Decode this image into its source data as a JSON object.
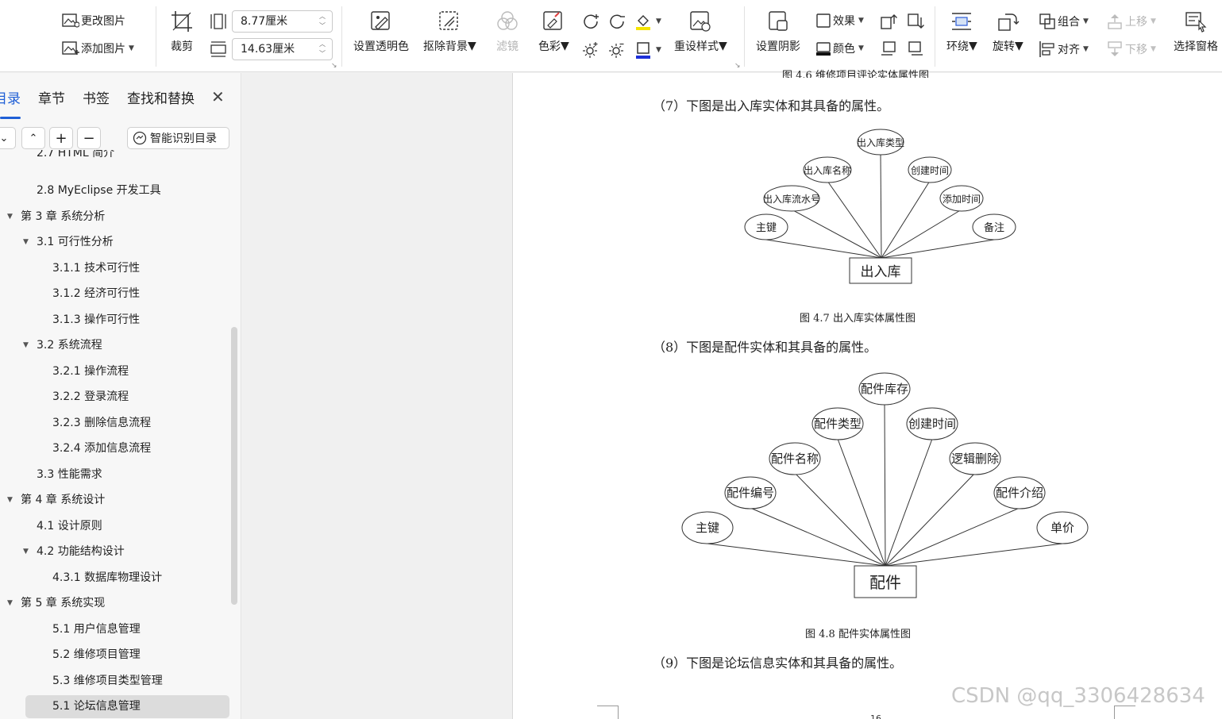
{
  "toolbar": {
    "change_image": "更改图片",
    "add_image": "添加图片",
    "crop": "裁剪",
    "width_value": "8.77厘米",
    "height_value": "14.63厘米",
    "set_transparent": "设置透明色",
    "remove_bg": "抠除背景",
    "filter": "滤镜",
    "color": "色彩",
    "reset_style": "重设样式",
    "set_shadow": "设置阴影",
    "effects": "效果",
    "shadow_color": "颜色",
    "wrap": "环绕",
    "rotate": "旋转",
    "group": "组合",
    "align": "对齐",
    "move_up": "上移",
    "move_down": "下移",
    "selection_pane": "选择窗格"
  },
  "sidebar": {
    "tabs": [
      "目录",
      "章节",
      "书签",
      "查找和替换"
    ],
    "smart_toc": "智能识别目录",
    "toc_partial": "2.7 HTML 简介",
    "toc": [
      "2.8 MyEclipse 开发工具",
      "第 3 章  系统分析",
      "3.1  可行性分析",
      "3.1.1  技术可行性",
      "3.1.2  经济可行性",
      "3.1.3  操作可行性",
      "3.2  系统流程",
      "3.2.1  操作流程",
      "3.2.2  登录流程",
      "3.2.3  删除信息流程",
      "3.2.4  添加信息流程",
      "3.3  性能需求",
      "第 4 章  系统设计",
      "4.1  设计原则",
      "4.2  功能结构设计",
      "4.3.1  数据库物理设计",
      "第 5 章  系统实现",
      "5.1 用户信息管理",
      "5.2  维修项目管理",
      "5.3 维修项目类型管理",
      "5.1 论坛信息管理"
    ]
  },
  "document": {
    "top_caption_partial": "图 4.6  维修项目评论实体属性图",
    "para7": "（7）下图是出入库实体和其具备的属性。",
    "caption7": "图 4.7 出入库实体属性图",
    "para8": "（8）下图是配件实体和其具备的属性。",
    "caption8": "图 4.8 配件实体属性图",
    "para9": "（9）下图是论坛信息实体和其具备的属性。",
    "page_number_partial": "16"
  },
  "diagram1": {
    "entity": "出入库",
    "attributes": [
      "主键",
      "出入库流水号",
      "出入库名称",
      "出入库类型",
      "创建时间",
      "添加时间",
      "备注"
    ]
  },
  "diagram2": {
    "entity": "配件",
    "attributes": [
      "主键",
      "配件编号",
      "配件名称",
      "配件类型",
      "配件库存",
      "创建时间",
      "逻辑删除",
      "配件介绍",
      "单价"
    ]
  },
  "watermark": "CSDN @qq_3306428634"
}
